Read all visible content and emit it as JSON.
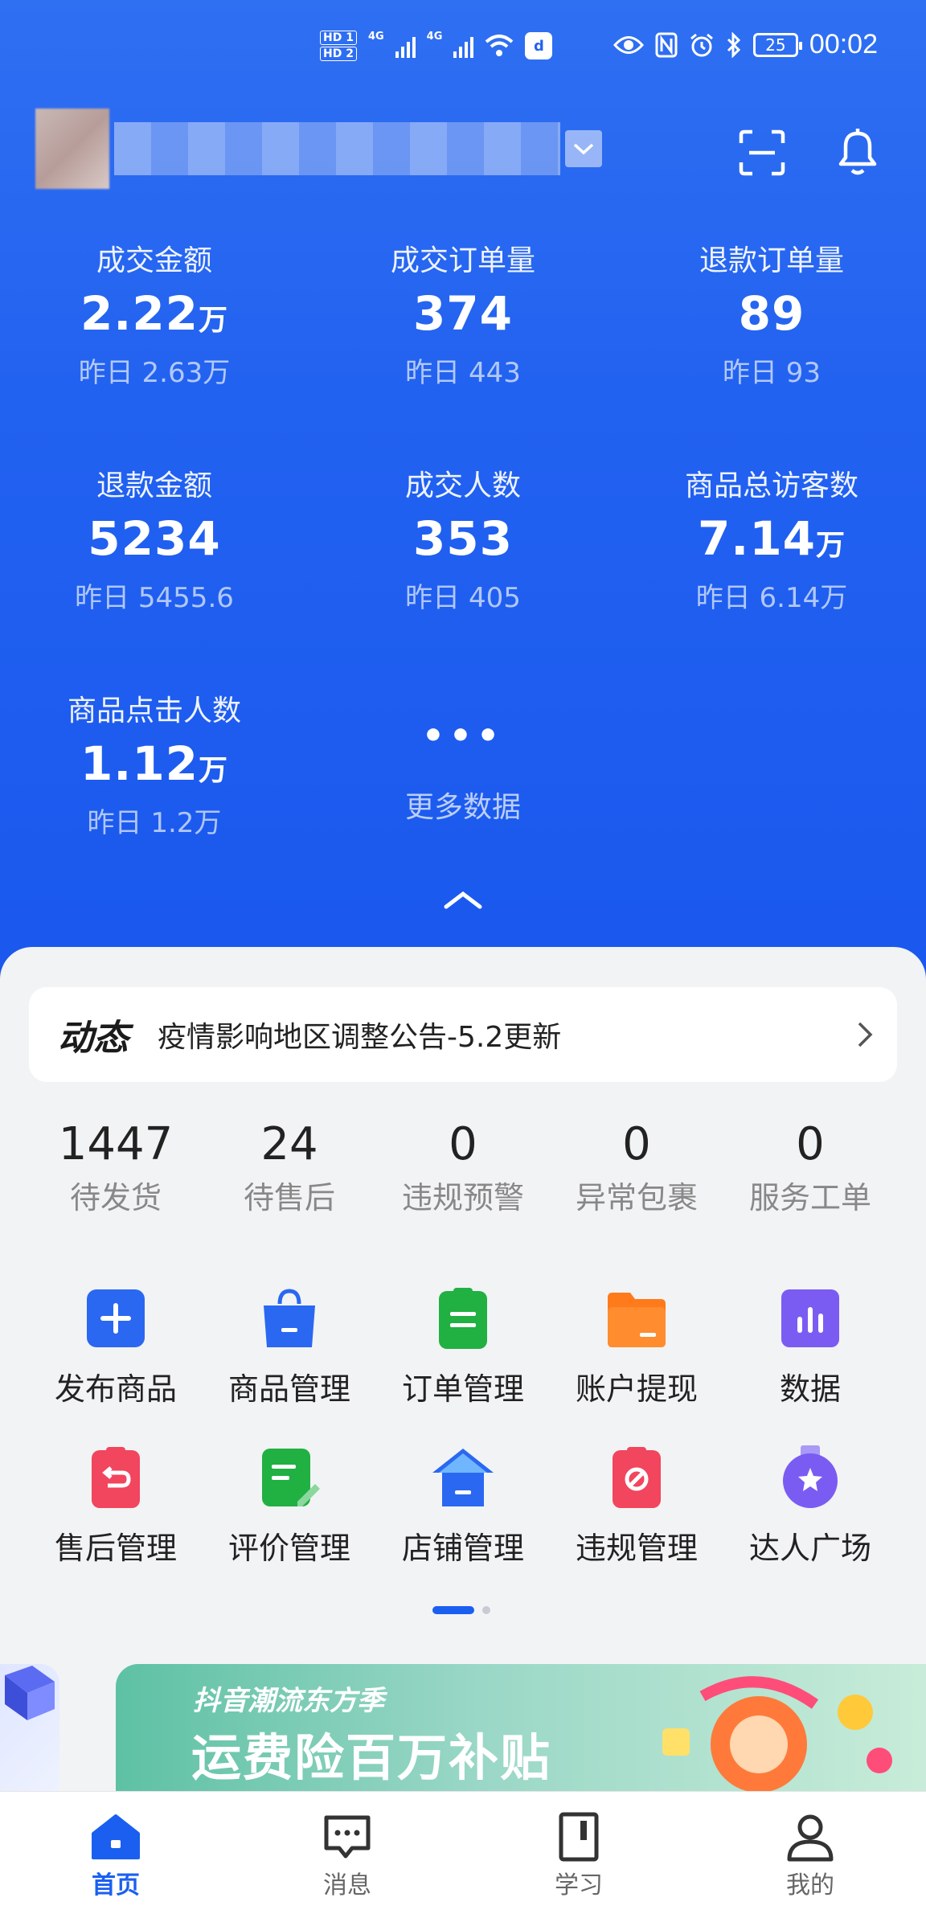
{
  "status_bar": {
    "hd1": "HD 1",
    "hd2": "HD 2",
    "sig1": "4G",
    "sig2": "4G",
    "battery": "25",
    "time": "00:02"
  },
  "metrics": [
    {
      "label": "成交金额",
      "value": "2.22",
      "unit": "万",
      "yesterday": "昨日 2.63万"
    },
    {
      "label": "成交订单量",
      "value": "374",
      "unit": "",
      "yesterday": "昨日 443"
    },
    {
      "label": "退款订单量",
      "value": "89",
      "unit": "",
      "yesterday": "昨日 93"
    },
    {
      "label": "退款金额",
      "value": "5234",
      "unit": "",
      "yesterday": "昨日 5455.6"
    },
    {
      "label": "成交人数",
      "value": "353",
      "unit": "",
      "yesterday": "昨日 405"
    },
    {
      "label": "商品总访客数",
      "value": "7.14",
      "unit": "万",
      "yesterday": "昨日 6.14万"
    },
    {
      "label": "商品点击人数",
      "value": "1.12",
      "unit": "万",
      "yesterday": "昨日 1.2万"
    }
  ],
  "more_data": {
    "dots": "•••",
    "label": "更多数据"
  },
  "notice": {
    "tag": "动态",
    "text": "疫情影响地区调整公告-5.2更新"
  },
  "pending": [
    {
      "value": "1447",
      "label": "待发货"
    },
    {
      "value": "24",
      "label": "待售后"
    },
    {
      "value": "0",
      "label": "违规预警"
    },
    {
      "value": "0",
      "label": "异常包裹"
    },
    {
      "value": "0",
      "label": "服务工单"
    }
  ],
  "tools": [
    {
      "label": "发布商品",
      "icon": "plus-square-icon"
    },
    {
      "label": "商品管理",
      "icon": "shopping-bag-icon"
    },
    {
      "label": "订单管理",
      "icon": "clipboard-icon"
    },
    {
      "label": "账户提现",
      "icon": "wallet-folder-icon"
    },
    {
      "label": "数据",
      "icon": "bar-chart-icon"
    },
    {
      "label": "售后管理",
      "icon": "return-clipboard-icon"
    },
    {
      "label": "评价管理",
      "icon": "review-edit-icon"
    },
    {
      "label": "店铺管理",
      "icon": "store-house-icon"
    },
    {
      "label": "违规管理",
      "icon": "prohibited-clipboard-icon"
    },
    {
      "label": "达人广场",
      "icon": "star-medal-icon"
    }
  ],
  "banner": {
    "subtitle": "抖音潮流东方季",
    "title": "运费险百万补贴"
  },
  "tabs": [
    {
      "label": "首页",
      "icon": "home-icon",
      "active": true
    },
    {
      "label": "消息",
      "icon": "message-icon",
      "active": false
    },
    {
      "label": "学习",
      "icon": "book-icon",
      "active": false
    },
    {
      "label": "我的",
      "icon": "user-icon",
      "active": false
    }
  ],
  "colors": {
    "primary": "#1a5ff0",
    "header_blue": "#2262f0"
  }
}
